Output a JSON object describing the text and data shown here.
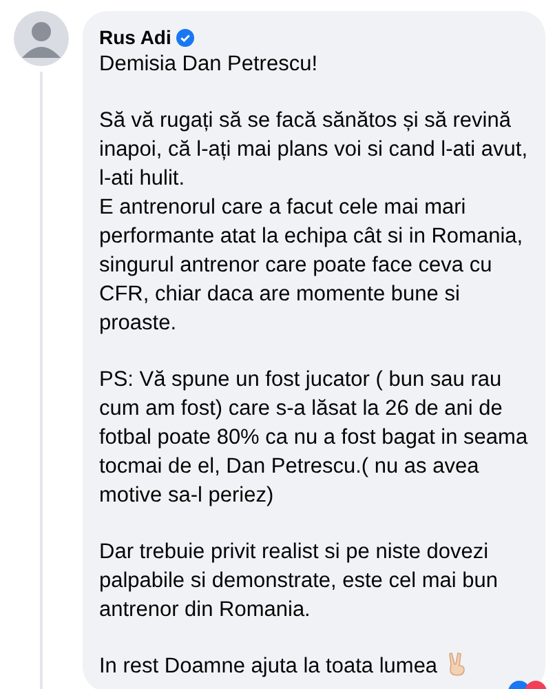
{
  "comment": {
    "author": "Rus Adi",
    "verified": true,
    "paragraphs": [
      "Demisia Dan Petrescu!",
      "Să vă rugați să se facă sănătos și să revină inapoi, că l-ați mai plans voi si cand l-ati avut, l-ati hulit.\nE antrenorul care a facut cele mai mari performante atat la echipa cât si in Romania, singurul antrenor care poate face ceva cu CFR, chiar daca are momente bune si proaste.",
      "PS: Vă spune un fost jucator ( bun sau rau cum am fost) care s-a lăsat la 26 de ani de fotbal poate 80% ca nu a fost bagat in seama tocmai de el, Dan Petrescu.( nu as avea motive sa-l periez)",
      "Dar trebuie privit realist si pe niste dovezi palpabile si demonstrate, este cel mai bun antrenor din Romania.",
      "In rest Doamne ajuta la toata lumea"
    ]
  }
}
